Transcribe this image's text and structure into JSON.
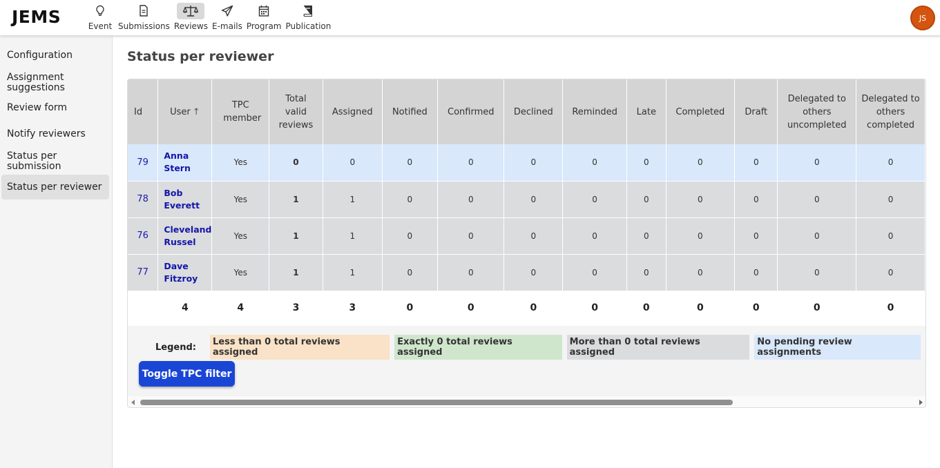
{
  "app": {
    "logo": "JEMS",
    "avatar_initials": "JS",
    "avatar_color": "#d4550f"
  },
  "nav": [
    {
      "label": "Event",
      "icon": "lightbulb-icon"
    },
    {
      "label": "Submissions",
      "icon": "document-icon"
    },
    {
      "label": "Reviews",
      "icon": "scales-icon",
      "active": true
    },
    {
      "label": "E-mails",
      "icon": "paper-plane-icon"
    },
    {
      "label": "Program",
      "icon": "calendar-icon"
    },
    {
      "label": "Publication",
      "icon": "book-icon"
    }
  ],
  "sidebar": {
    "items": [
      {
        "label": "Configuration"
      },
      {
        "label": "Assignment suggestions"
      },
      {
        "label": "Review form"
      },
      {
        "label": "Notify reviewers"
      },
      {
        "label": "Status per submission"
      },
      {
        "label": "Status per reviewer",
        "active": true
      }
    ]
  },
  "page": {
    "title": "Status per reviewer"
  },
  "table": {
    "headers": [
      "Id",
      "User",
      "TPC member",
      "Total valid reviews",
      "Assigned",
      "Notified",
      "Confirmed",
      "Declined",
      "Reminded",
      "Late",
      "Completed",
      "Draft",
      "Delegated to others uncompleted",
      "Delegated to others completed"
    ],
    "rows": [
      {
        "id": "79",
        "first": "Anna",
        "last": "Stern",
        "tpc": "Yes",
        "vals": [
          "0",
          "0",
          "0",
          "0",
          "0",
          "0",
          "0",
          "0",
          "0",
          "0",
          "0"
        ],
        "status": "blue"
      },
      {
        "id": "78",
        "first": "Bob",
        "last": "Everett",
        "tpc": "Yes",
        "vals": [
          "1",
          "1",
          "0",
          "0",
          "0",
          "0",
          "0",
          "0",
          "0",
          "0",
          "0"
        ],
        "status": "gray"
      },
      {
        "id": "76",
        "first": "Cleveland",
        "last": "Russel",
        "tpc": "Yes",
        "vals": [
          "1",
          "1",
          "0",
          "0",
          "0",
          "0",
          "0",
          "0",
          "0",
          "0",
          "0"
        ],
        "status": "gray"
      },
      {
        "id": "77",
        "first": "Dave",
        "last": "Fitzroy",
        "tpc": "Yes",
        "vals": [
          "1",
          "1",
          "0",
          "0",
          "0",
          "0",
          "0",
          "0",
          "0",
          "0",
          "0"
        ],
        "status": "gray"
      }
    ],
    "totals": [
      "",
      "4",
      "4",
      "3",
      "3",
      "0",
      "0",
      "0",
      "0",
      "0",
      "0",
      "0",
      "0",
      "0"
    ]
  },
  "legend": {
    "title": "Legend:",
    "items": [
      {
        "label": "Less than 0 total reviews assigned",
        "color": "#f9e2c7"
      },
      {
        "label": "Exactly 0 total reviews assigned",
        "color": "#cfe6cc"
      },
      {
        "label": "More than 0 total reviews assigned",
        "color": "#dadcde"
      },
      {
        "label": "No pending review assignments",
        "color": "#d9e8fb"
      }
    ]
  },
  "toggle_button": "Toggle TPC filter"
}
